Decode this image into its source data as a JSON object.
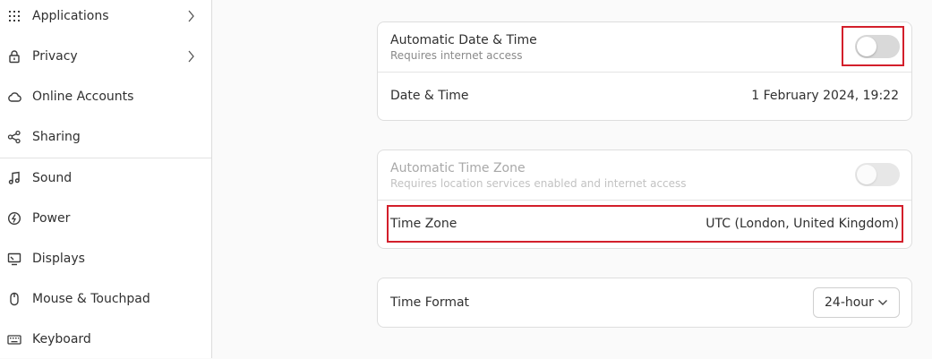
{
  "sidebar": {
    "items": [
      {
        "label": "Applications",
        "icon": "grid-icon",
        "has_chevron": true
      },
      {
        "label": "Privacy",
        "icon": "lock-icon",
        "has_chevron": true
      },
      {
        "label": "Online Accounts",
        "icon": "cloud-icon",
        "has_chevron": false
      },
      {
        "label": "Sharing",
        "icon": "share-icon",
        "has_chevron": false
      },
      {
        "label": "Sound",
        "icon": "music-note-icon",
        "has_chevron": false
      },
      {
        "label": "Power",
        "icon": "power-icon",
        "has_chevron": false
      },
      {
        "label": "Displays",
        "icon": "display-icon",
        "has_chevron": false
      },
      {
        "label": "Mouse & Touchpad",
        "icon": "mouse-icon",
        "has_chevron": false
      },
      {
        "label": "Keyboard",
        "icon": "keyboard-icon",
        "has_chevron": false
      }
    ]
  },
  "datetime_card": {
    "auto_datetime": {
      "title": "Automatic Date & Time",
      "subtitle": "Requires internet access",
      "enabled": false
    },
    "date_time": {
      "title": "Date & Time",
      "value": "1 February 2024, 19:22"
    }
  },
  "timezone_card": {
    "auto_timezone": {
      "title": "Automatic Time Zone",
      "subtitle": "Requires location services enabled and internet access",
      "enabled": false,
      "sensitive": false
    },
    "time_zone": {
      "title": "Time Zone",
      "value": "UTC (London, United Kingdom)"
    }
  },
  "format_card": {
    "time_format": {
      "title": "Time Format",
      "selected": "24-hour"
    }
  },
  "colors": {
    "highlight": "#d31f2b",
    "toggle_off": "#d9d9d9",
    "background": "#fafafa"
  }
}
